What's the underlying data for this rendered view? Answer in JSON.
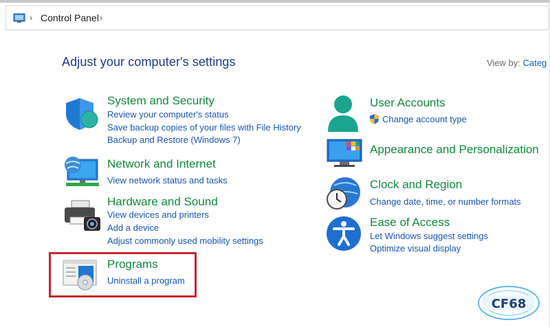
{
  "addressbar": {
    "crumb": "Control Panel"
  },
  "page": {
    "title": "Adjust your computer's settings"
  },
  "view_by": {
    "label": "View by:",
    "value": "Categ"
  },
  "left_categories": [
    {
      "title": "System and Security",
      "links": [
        "Review your computer's status",
        "Save backup copies of your files with File History",
        "Backup and Restore (Windows 7)"
      ]
    },
    {
      "title": "Network and Internet",
      "links": [
        "View network status and tasks"
      ]
    },
    {
      "title": "Hardware and Sound",
      "links": [
        "View devices and printers",
        "Add a device",
        "Adjust commonly used mobility settings"
      ]
    },
    {
      "title": "Programs",
      "links": [
        "Uninstall a program"
      ]
    }
  ],
  "right_categories": [
    {
      "title": "User Accounts",
      "links": [
        "Change account type"
      ]
    },
    {
      "title": "Appearance and Personalization",
      "links": []
    },
    {
      "title": "Clock and Region",
      "links": [
        "Change date, time, or number formats"
      ]
    },
    {
      "title": "Ease of Access",
      "links": [
        "Let Windows suggest settings",
        "Optimize visual display"
      ]
    }
  ],
  "watermark": {
    "brand": "CF68"
  },
  "colors": {
    "title_blue": "#1e3a8a",
    "category_green": "#118a3c",
    "link_blue": "#1755b8",
    "highlight_red": "#c9262b"
  }
}
